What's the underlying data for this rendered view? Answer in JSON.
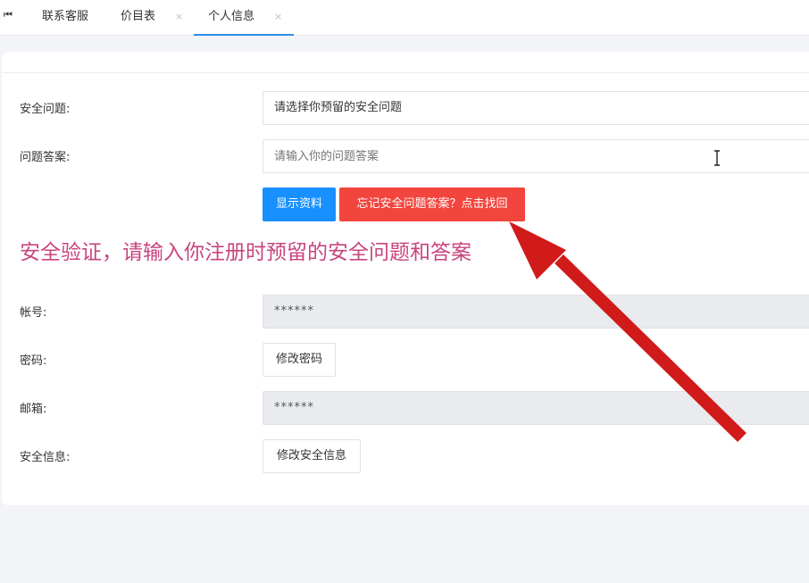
{
  "tabs": {
    "first_icon": "⏮",
    "items": [
      {
        "label": "联系客服",
        "closable": false
      },
      {
        "label": "价目表",
        "closable": true
      },
      {
        "label": "个人信息",
        "closable": true,
        "active": true
      }
    ],
    "close_glyph": "×"
  },
  "security": {
    "question_label": "安全问题:",
    "question_select": "请选择你预留的安全问题",
    "answer_label": "问题答案:",
    "answer_placeholder": "请输入你的问题答案",
    "show_button": "显示资料",
    "forgot_button": "忘记安全问题答案？点击找回",
    "notice": "安全验证，请输入你注册时预留的安全问题和答案"
  },
  "profile": {
    "account_label": "帐号:",
    "account_value": "******",
    "password_label": "密码:",
    "password_button": "修改密码",
    "email_label": "邮箱:",
    "email_value": "******",
    "security_info_label": "安全信息:",
    "security_info_button": "修改安全信息"
  },
  "colors": {
    "primary": "#1890ff",
    "danger": "#f2453d",
    "notice": "#c8457f",
    "arrow": "#d11a1a",
    "tab_active": "#2d8cf0"
  },
  "icons": {
    "text_cursor": "text-cursor-icon",
    "arrow": "red-arrow-annotation"
  }
}
